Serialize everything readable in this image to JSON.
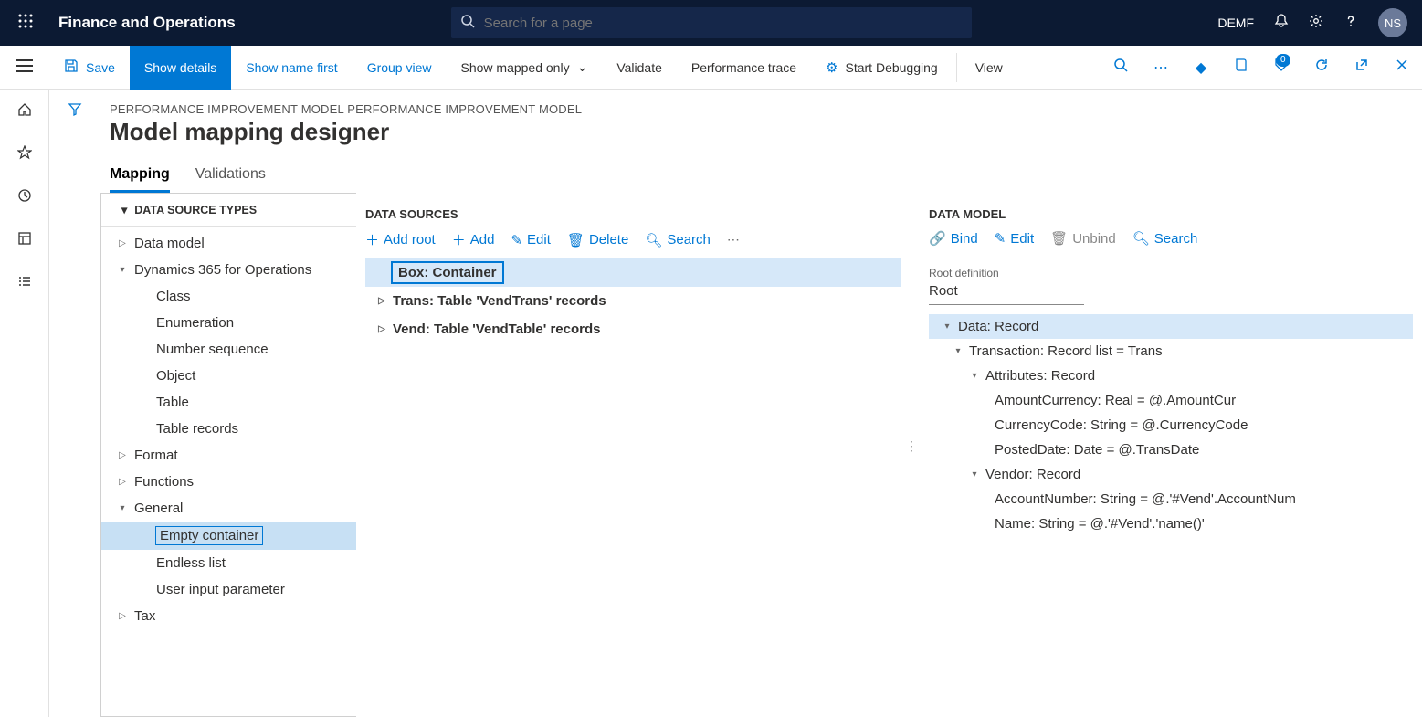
{
  "topbar": {
    "app_name": "Finance and Operations",
    "search_placeholder": "Search for a page",
    "company": "DEMF",
    "avatar": "NS"
  },
  "actionbar": {
    "save": "Save",
    "show_details": "Show details",
    "show_name_first": "Show name first",
    "group_view": "Group view",
    "show_mapped_only": "Show mapped only",
    "validate": "Validate",
    "perf_trace": "Performance trace",
    "start_debugging": "Start Debugging",
    "view": "View",
    "badge_count": "0"
  },
  "page": {
    "breadcrumb": "PERFORMANCE IMPROVEMENT MODEL PERFORMANCE IMPROVEMENT MODEL",
    "title": "Model mapping designer"
  },
  "tabs": {
    "mapping": "Mapping",
    "validations": "Validations"
  },
  "panel1": {
    "header": "DATA SOURCE TYPES",
    "nodes": {
      "data_model": "Data model",
      "d365": "Dynamics 365 for Operations",
      "class": "Class",
      "enum": "Enumeration",
      "numseq": "Number sequence",
      "object": "Object",
      "table": "Table",
      "tablerecs": "Table records",
      "format": "Format",
      "functions": "Functions",
      "general": "General",
      "empty_container": "Empty container",
      "endless_list": "Endless list",
      "user_input": "User input parameter",
      "tax": "Tax"
    }
  },
  "panel2": {
    "header": "DATA SOURCES",
    "toolbar": {
      "add_root": "Add root",
      "add": "Add",
      "edit": "Edit",
      "delete": "Delete",
      "search": "Search"
    },
    "rows": {
      "box": "Box: Container",
      "trans": "Trans: Table 'VendTrans' records",
      "vend": "Vend: Table 'VendTable' records"
    }
  },
  "panel3": {
    "header": "DATA MODEL",
    "toolbar": {
      "bind": "Bind",
      "edit": "Edit",
      "unbind": "Unbind",
      "search": "Search"
    },
    "root_label": "Root definition",
    "root_value": "Root",
    "rows": {
      "data": "Data: Record",
      "transaction": "Transaction: Record list = Trans",
      "attributes": "Attributes: Record",
      "amountcur": "AmountCurrency: Real = @.AmountCur",
      "currcode": "CurrencyCode: String = @.CurrencyCode",
      "posteddate": "PostedDate: Date = @.TransDate",
      "vendor": "Vendor: Record",
      "accnum": "AccountNumber: String = @.'#Vend'.AccountNum",
      "vendname": "Name: String = @.'#Vend'.'name()'"
    }
  }
}
